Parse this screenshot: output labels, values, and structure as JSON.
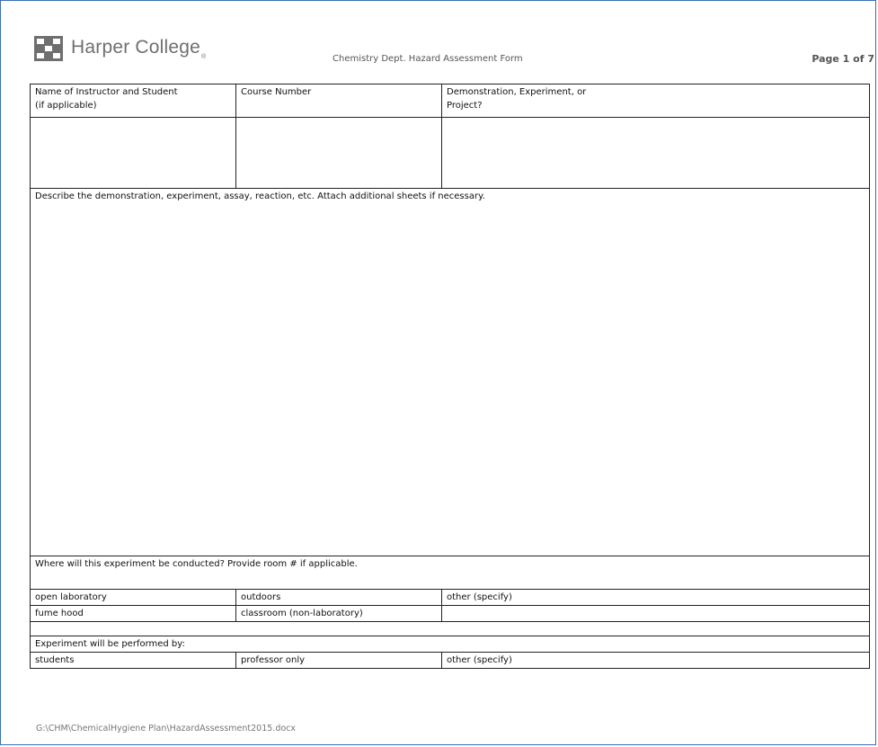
{
  "header": {
    "logo_text": "Harper College",
    "logo_reg": "®",
    "form_title": "Chemistry Dept. Hazard Assessment Form",
    "page_number": "Page 1 of 7"
  },
  "table": {
    "col_headers": [
      {
        "line1": "Name of Instructor and Student",
        "line2": "(if applicable)"
      },
      {
        "line1": "Course Number",
        "line2": ""
      },
      {
        "line1": "Demonstration,  Experiment,  or",
        "line2": "Project?"
      }
    ],
    "description_prompt": "Describe the demonstration,  experiment, assay, reaction, etc. Attach additional  sheets if necessary.",
    "location_prompt": "Where will this experiment  be conducted?  Provide room # if applicable.",
    "location_options": [
      [
        "open laboratory",
        "outdoors",
        "other  (specify)"
      ],
      [
        "fume hood",
        "classroom (non-laboratory)",
        ""
      ]
    ],
    "performer_prompt": "Experiment  will be performed by:",
    "performer_options": [
      "students",
      "professor  only",
      "other  (specify)"
    ]
  },
  "footer": {
    "path": "G:\\CHM\\ChemicalHygiene Plan\\HazardAssessment2015.docx"
  },
  "colors": {
    "frame_border": "#3a6fb0",
    "logo_gray": "#6f6f6f"
  },
  "icons": {
    "logo": "harper-college-logo-icon"
  }
}
